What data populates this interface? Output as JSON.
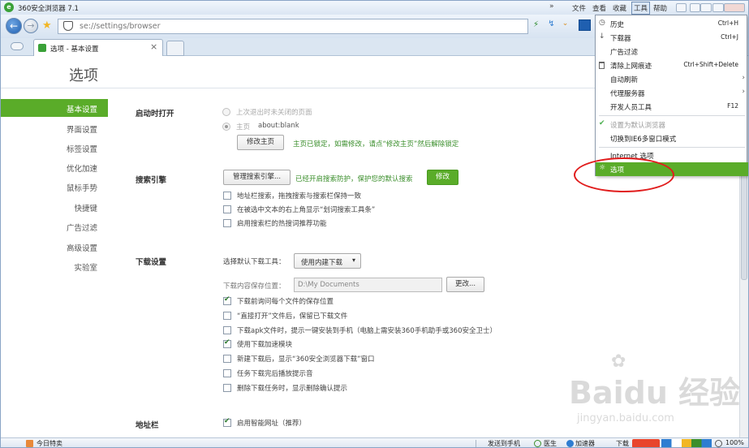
{
  "window": {
    "title": "360安全浏览器 7.1"
  },
  "menubar": {
    "items": [
      "文件",
      "查看",
      "收藏",
      "工具",
      "帮助"
    ]
  },
  "address": {
    "url": "se://settings/browser"
  },
  "tabs": [
    {
      "label": "选项 - 基本设置",
      "close": "×"
    }
  ],
  "page": {
    "title": "选项"
  },
  "sidebar": {
    "items": [
      "基本设置",
      "界面设置",
      "标签设置",
      "优化加速",
      "鼠标手势",
      "快捷键",
      "广告过滤",
      "高级设置",
      "实验室"
    ],
    "active_index": 0
  },
  "startup": {
    "title": "启动时打开",
    "option1": "上次退出时未关闭的页面",
    "option2_label": "主页",
    "option2_value": "about:blank",
    "modify_button": "修改主页",
    "lock_note": "主页已锁定，如需修改，请点“修改主页”然后解除锁定"
  },
  "search": {
    "title": "搜索引擎",
    "manage_button": "管理搜索引擎...",
    "protect_note": "已经开启搜索防护，保护您的默认搜索",
    "modify_button": "修改",
    "options": [
      {
        "label": "地址栏搜索，拖拽搜索与搜索栏保持一致",
        "checked": false
      },
      {
        "label": "在被选中文本的右上角显示“划词搜索工具条”",
        "checked": false
      },
      {
        "label": "启用搜索栏的热搜词推荐功能",
        "checked": false
      }
    ]
  },
  "download": {
    "title": "下载设置",
    "tool_label": "选择默认下载工具：",
    "tool_value": "使用内建下载",
    "path_label": "下载内容保存位置：",
    "path_value": "D:\\My Documents",
    "change_button": "更改...",
    "options": [
      {
        "label": "下载前询问每个文件的保存位置",
        "checked": true
      },
      {
        "label": "“直接打开”文件后，保留已下载文件",
        "checked": false
      },
      {
        "label": "下载apk文件时，提示一键安装到手机（电脑上需安装360手机助手或360安全卫士）",
        "checked": false
      },
      {
        "label": "使用下载加速模块",
        "checked": true
      },
      {
        "label": "新建下载后，显示“360安全浏览器下载”窗口",
        "checked": false
      },
      {
        "label": "任务下载完后播放提示音",
        "checked": false
      },
      {
        "label": "删除下载任务时，显示删除确认提示",
        "checked": false
      }
    ]
  },
  "addressbar": {
    "title": "地址栏",
    "options": [
      {
        "label": "启用智能网址（推荐）",
        "checked": true
      }
    ]
  },
  "tools_menu": {
    "items": [
      {
        "label": "历史",
        "shortcut": "Ctrl+H",
        "icon": "clock-icon",
        "glyph": "◷"
      },
      {
        "label": "下载器",
        "shortcut": "Ctrl+J",
        "icon": "download-arrow-icon",
        "glyph": "↓"
      },
      {
        "label": "广告过滤",
        "shortcut": "",
        "icon": "",
        "glyph": ""
      },
      {
        "label": "清除上网痕迹",
        "shortcut": "Ctrl+Shift+Delete",
        "icon": "trash-icon",
        "glyph": "🗑"
      },
      {
        "label": "自动刷新",
        "shortcut": "",
        "icon": "",
        "glyph": "",
        "submenu": true
      },
      {
        "label": "代理服务器",
        "shortcut": "",
        "icon": "",
        "glyph": "",
        "submenu": true
      },
      {
        "label": "开发人员工具",
        "shortcut": "F12",
        "icon": "",
        "glyph": ""
      },
      {
        "label": "设置为默认浏览器",
        "shortcut": "",
        "icon": "checkmark-icon",
        "glyph": "✔",
        "disabled": true
      },
      {
        "label": "切换到IE6多窗口模式",
        "shortcut": "",
        "icon": "",
        "glyph": ""
      },
      {
        "label": "Internet 选项",
        "shortcut": "",
        "icon": "",
        "glyph": ""
      },
      {
        "label": "选项",
        "shortcut": "",
        "icon": "gear-icon",
        "glyph": "☼",
        "highlighted": true
      }
    ]
  },
  "statusbar": {
    "left": "今日特卖",
    "send_phone": "发送到手机",
    "doctor": "医生",
    "accelerator": "加速器",
    "download": "下载",
    "zoom": "100%"
  },
  "watermark": {
    "text": "Baidu 经验",
    "sub": "jingyan.baidu.com"
  },
  "colors": {
    "accent": "#5aac29",
    "highlight_ring": "#e11d1d",
    "link_green": "#3a8e2b"
  }
}
